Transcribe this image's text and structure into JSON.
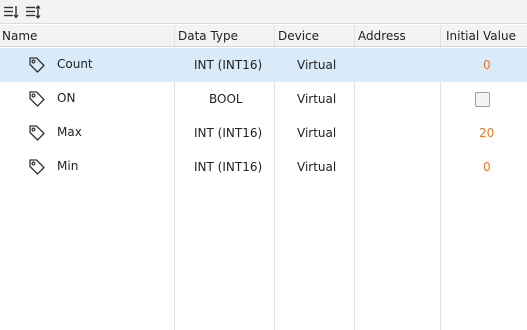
{
  "toolbar": {
    "icons": [
      "collapse-all-icon",
      "expand-all-icon"
    ]
  },
  "columns": {
    "name": "Name",
    "data_type": "Data Type",
    "device": "Device",
    "address": "Address",
    "initial_value": "Initial Value"
  },
  "rows": [
    {
      "name": "Count",
      "data_type": "INT (INT16)",
      "device": "Virtual",
      "address": "",
      "initial_value": "0",
      "selected": true
    },
    {
      "name": "ON",
      "data_type": "BOOL",
      "device": "Virtual",
      "address": "",
      "initial_value": "",
      "checkbox_checked": false
    },
    {
      "name": "Max",
      "data_type": "INT (INT16)",
      "device": "Virtual",
      "address": "",
      "initial_value": "20"
    },
    {
      "name": "Min",
      "data_type": "INT (INT16)",
      "device": "Virtual",
      "address": "",
      "initial_value": "0"
    }
  ],
  "colors": {
    "selected_row": "#d9eaf9",
    "initial_value_text": "#e8792a"
  }
}
